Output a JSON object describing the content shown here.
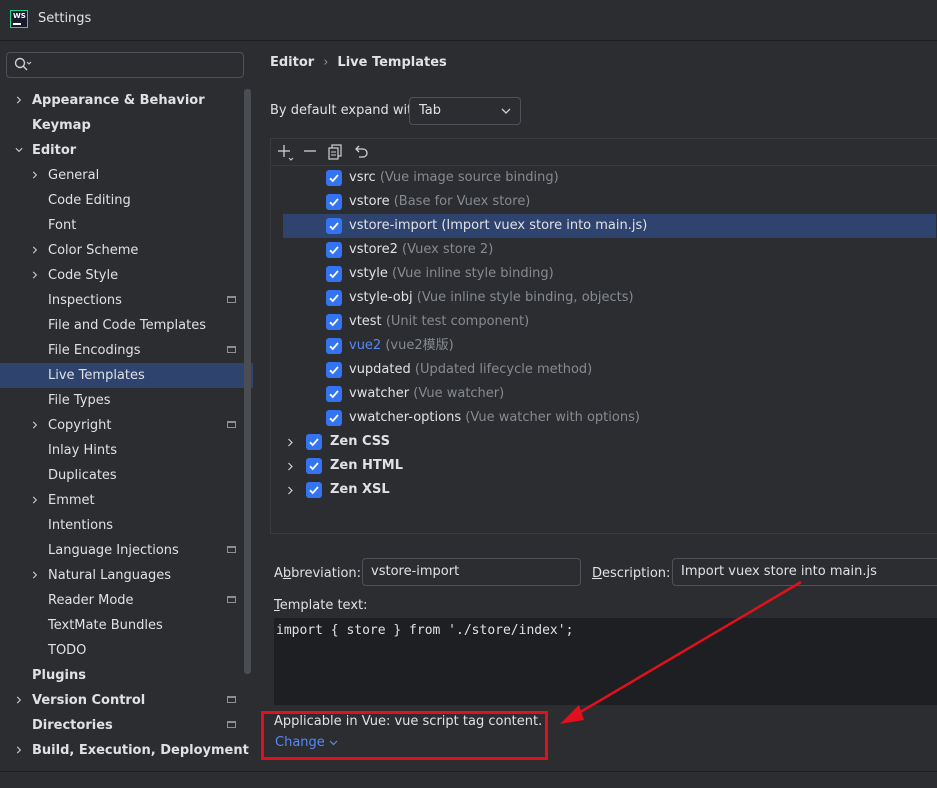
{
  "window": {
    "title": "Settings",
    "logo_text": "WS"
  },
  "sidebar": {
    "search": {
      "value": "",
      "placeholder": ""
    },
    "items": [
      {
        "label": "Appearance & Behavior",
        "level": 0,
        "expandable": true,
        "expanded": false,
        "bold": true
      },
      {
        "label": "Keymap",
        "level": 0,
        "expandable": false,
        "bold": true
      },
      {
        "label": "Editor",
        "level": 0,
        "expandable": true,
        "expanded": true,
        "bold": true
      },
      {
        "label": "General",
        "level": 1,
        "expandable": true
      },
      {
        "label": "Code Editing",
        "level": 1
      },
      {
        "label": "Font",
        "level": 1
      },
      {
        "label": "Color Scheme",
        "level": 1,
        "expandable": true
      },
      {
        "label": "Code Style",
        "level": 1,
        "expandable": true
      },
      {
        "label": "Inspections",
        "level": 1,
        "project": true
      },
      {
        "label": "File and Code Templates",
        "level": 1
      },
      {
        "label": "File Encodings",
        "level": 1,
        "project": true
      },
      {
        "label": "Live Templates",
        "level": 1,
        "selected": true
      },
      {
        "label": "File Types",
        "level": 1
      },
      {
        "label": "Copyright",
        "level": 1,
        "expandable": true,
        "project": true
      },
      {
        "label": "Inlay Hints",
        "level": 1
      },
      {
        "label": "Duplicates",
        "level": 1
      },
      {
        "label": "Emmet",
        "level": 1,
        "expandable": true
      },
      {
        "label": "Intentions",
        "level": 1
      },
      {
        "label": "Language Injections",
        "level": 1,
        "project": true
      },
      {
        "label": "Natural Languages",
        "level": 1,
        "expandable": true
      },
      {
        "label": "Reader Mode",
        "level": 1,
        "project": true
      },
      {
        "label": "TextMate Bundles",
        "level": 1
      },
      {
        "label": "TODO",
        "level": 1
      },
      {
        "label": "Plugins",
        "level": 0,
        "bold": true
      },
      {
        "label": "Version Control",
        "level": 0,
        "expandable": true,
        "bold": true,
        "project": true
      },
      {
        "label": "Directories",
        "level": 0,
        "bold": true,
        "project": true
      },
      {
        "label": "Build, Execution, Deployment",
        "level": 0,
        "expandable": true,
        "bold": true
      }
    ]
  },
  "breadcrumb": {
    "parent": "Editor",
    "separator": "›",
    "current": "Live Templates"
  },
  "expand": {
    "label": "By default expand with",
    "value": "Tab"
  },
  "templates": [
    {
      "abbr": "vsrc",
      "desc": "(Vue image source binding)",
      "checked": true
    },
    {
      "abbr": "vstore",
      "desc": "(Base for Vuex store)",
      "checked": true
    },
    {
      "abbr": "vstore-import",
      "desc": "(Import vuex store into main.js)",
      "checked": true,
      "selected": true
    },
    {
      "abbr": "vstore2",
      "desc": "(Vuex store 2)",
      "checked": true
    },
    {
      "abbr": "vstyle",
      "desc": "(Vue inline style binding)",
      "checked": true
    },
    {
      "abbr": "vstyle-obj",
      "desc": "(Vue inline style binding, objects)",
      "checked": true
    },
    {
      "abbr": "vtest",
      "desc": "(Unit test component)",
      "checked": true
    },
    {
      "abbr": "vue2",
      "desc": "(vue2模版)",
      "checked": true,
      "link": true
    },
    {
      "abbr": "vupdated",
      "desc": "(Updated lifecycle method)",
      "checked": true
    },
    {
      "abbr": "vwatcher",
      "desc": "(Vue watcher)",
      "checked": true
    },
    {
      "abbr": "vwatcher-options",
      "desc": "(Vue watcher with options)",
      "checked": true
    }
  ],
  "groups": [
    {
      "name": "Zen CSS",
      "checked": true
    },
    {
      "name": "Zen HTML",
      "checked": true
    },
    {
      "name": "Zen XSL",
      "checked": true
    }
  ],
  "details": {
    "abbr_label": "Abbreviation:",
    "abbr_value": "vstore-import",
    "desc_label": "Description:",
    "desc_value": "Import vuex store into main.js",
    "template_text_label": "Template text:",
    "template_text": "import { store } from './store/index';",
    "applicable": "Applicable in Vue: vue script tag content.",
    "change": "Change"
  },
  "colors": {
    "background": "#2b2d30",
    "selection": "#2e436e",
    "accent": "#3574f0",
    "link": "#548af7",
    "annotation": "#e0111b"
  }
}
